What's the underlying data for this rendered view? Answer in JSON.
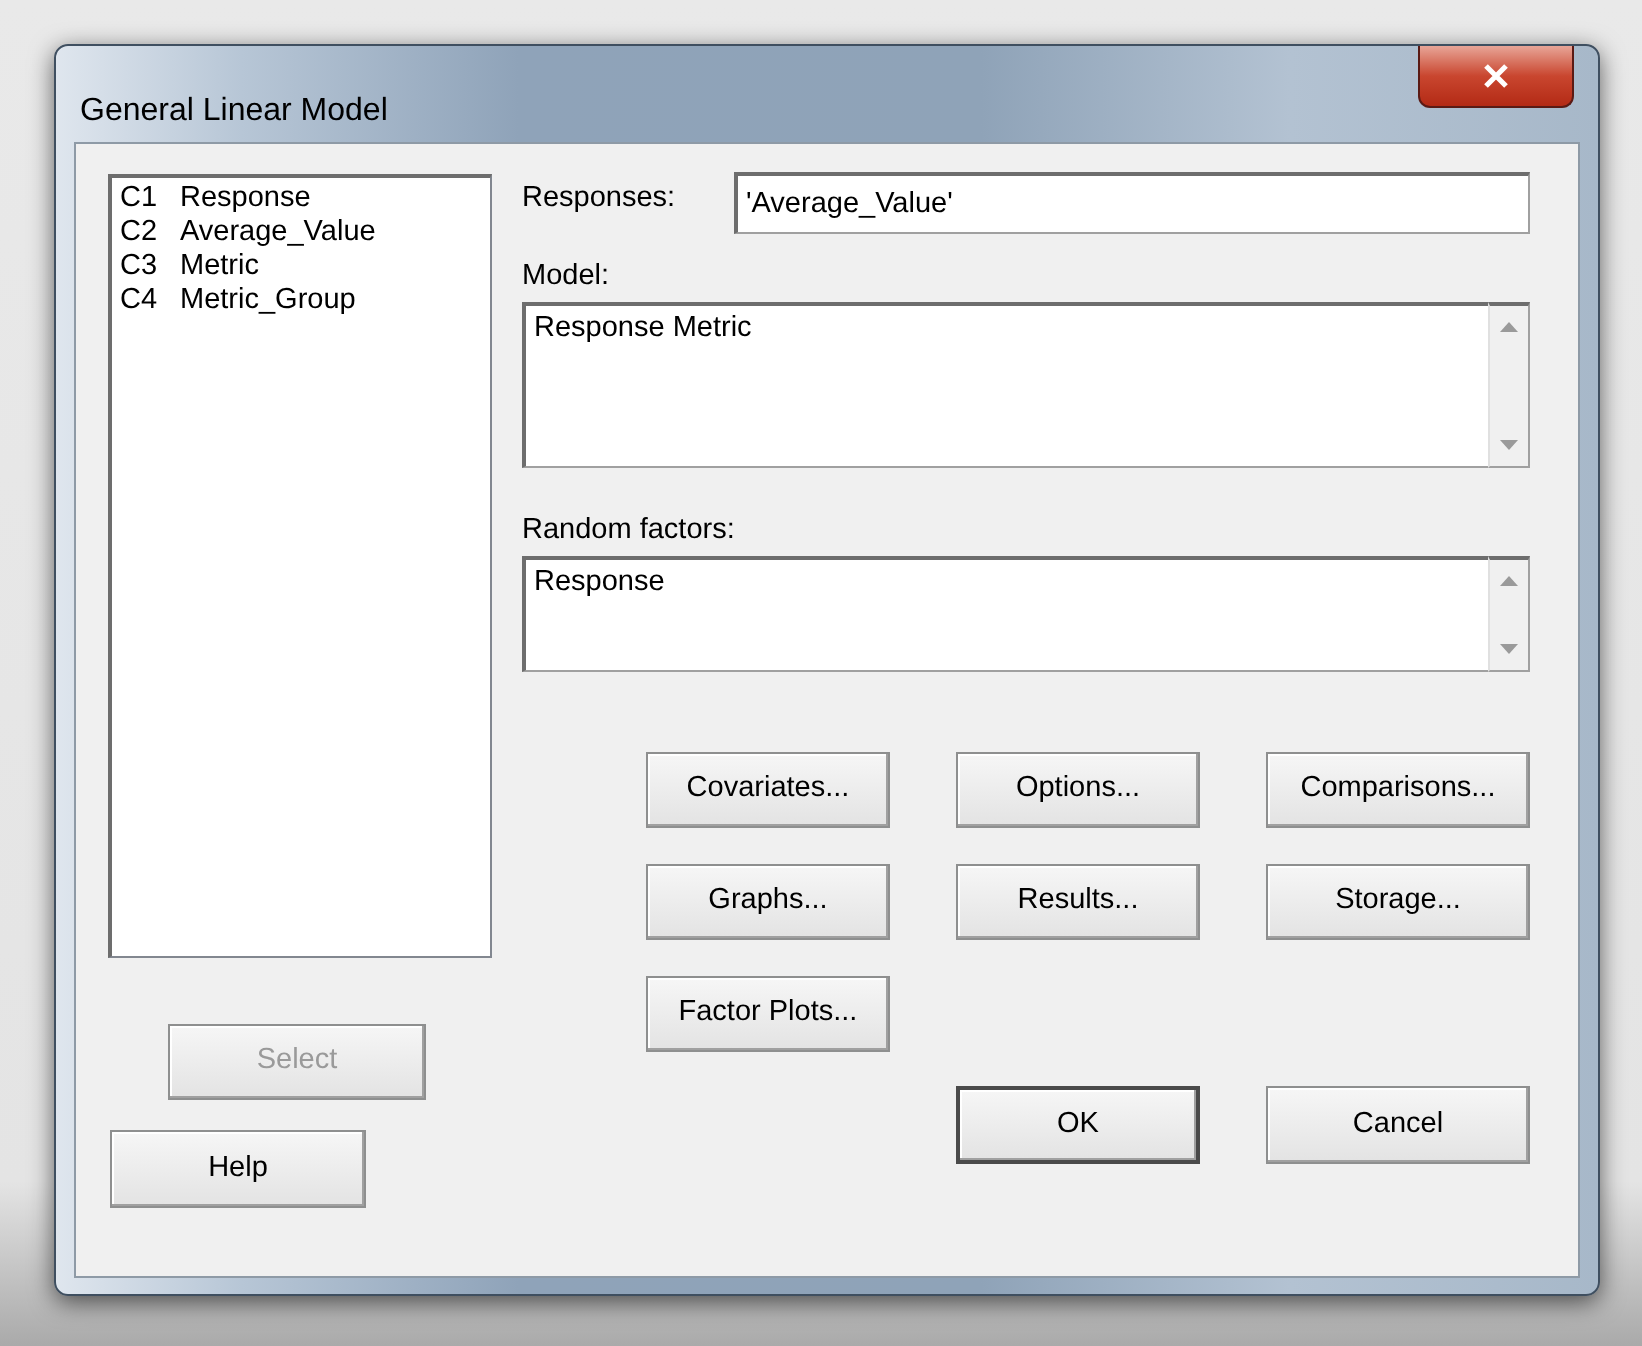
{
  "window": {
    "title": "General Linear Model"
  },
  "columns": [
    {
      "number": "C1",
      "name": "Response"
    },
    {
      "number": "C2",
      "name": "Average_Value"
    },
    {
      "number": "C3",
      "name": "Metric"
    },
    {
      "number": "C4",
      "name": "Metric_Group"
    }
  ],
  "responses": {
    "label": "Responses:",
    "value": "'Average_Value'"
  },
  "model": {
    "label": "Model:",
    "value": "Response Metric"
  },
  "random_factors": {
    "label": "Random factors:",
    "value": "Response"
  },
  "option_buttons": [
    {
      "label": "Covariates..."
    },
    {
      "label": "Options..."
    },
    {
      "label": "Comparisons..."
    },
    {
      "label": "Graphs..."
    },
    {
      "label": "Results..."
    },
    {
      "label": "Storage..."
    },
    {
      "label": "Factor Plots..."
    }
  ],
  "left_buttons": [
    {
      "label": "Select",
      "disabled": true
    },
    {
      "label": "Help",
      "disabled": false
    }
  ],
  "dialog_buttons": [
    {
      "label": "OK",
      "default": true
    },
    {
      "label": "Cancel",
      "default": false
    }
  ]
}
